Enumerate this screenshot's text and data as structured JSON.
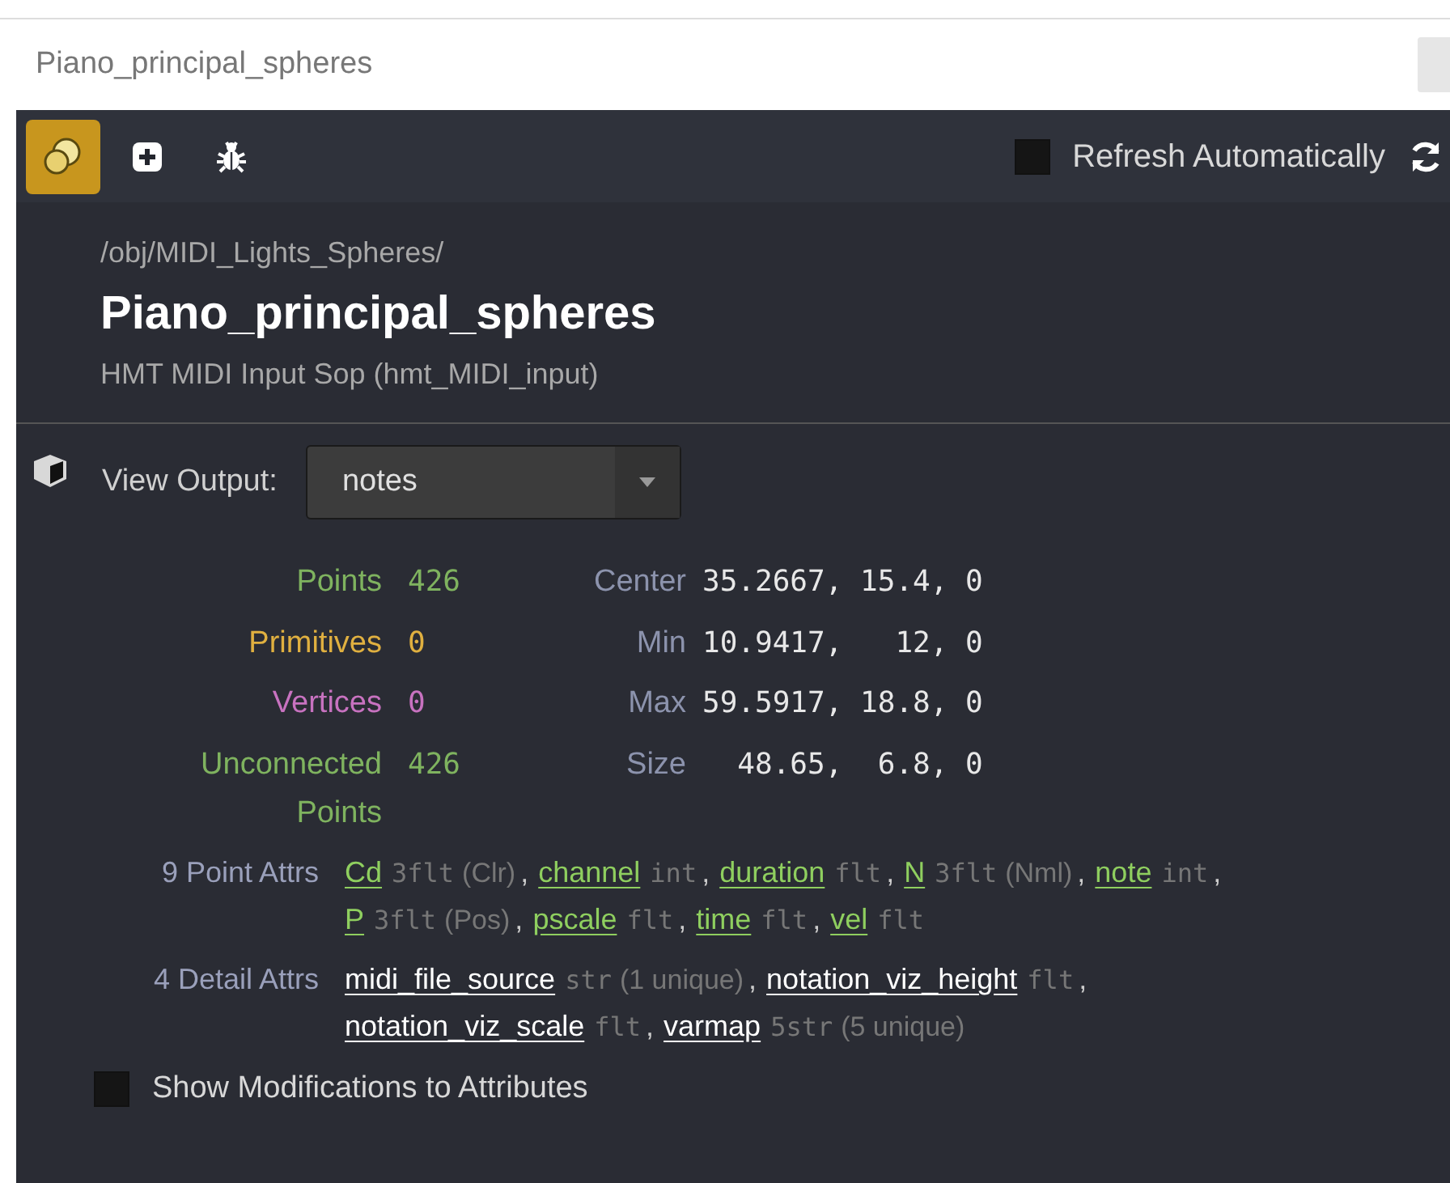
{
  "window": {
    "title": "Piano_principal_spheres"
  },
  "toolbar": {
    "buttons": [
      {
        "kind": "node",
        "selected": true
      },
      {
        "kind": "add",
        "selected": false
      },
      {
        "kind": "debug",
        "selected": false
      }
    ],
    "refresh": {
      "label": "Refresh Automatically",
      "checked": false
    }
  },
  "header": {
    "path": "/obj/MIDI_Lights_Spheres/",
    "name": "Piano_principal_spheres",
    "type": "HMT MIDI Input Sop (hmt_MIDI_input)"
  },
  "view_output": {
    "label": "View Output:",
    "value": "notes"
  },
  "counts": [
    {
      "label": "Points",
      "value": "426",
      "color": "#7fb35f"
    },
    {
      "label": "Primitives",
      "value": "0",
      "color": "#e0b040"
    },
    {
      "label": "Vertices",
      "value": "0",
      "color": "#c872c0"
    },
    {
      "label": "Unconnected Points",
      "value": "426",
      "color": "#7fb35f"
    }
  ],
  "bounds": [
    {
      "label": "Center",
      "value": "35.2667, 15.4, 0"
    },
    {
      "label": "Min",
      "value": "10.9417,   12, 0"
    },
    {
      "label": "Max",
      "value": "59.5917, 18.8, 0"
    },
    {
      "label": "Size",
      "value": "  48.65,  6.8, 0"
    }
  ],
  "attribute_groups": [
    {
      "label": "9 Point Attrs",
      "color": "#8fcf5f",
      "separator": ",",
      "attrs": [
        {
          "name": "Cd",
          "type": "3flt",
          "note": "(Clr)"
        },
        {
          "name": "channel",
          "type": "int"
        },
        {
          "name": "duration",
          "type": "flt"
        },
        {
          "name": "N",
          "type": "3flt",
          "note": "(Nml)"
        },
        {
          "name": "note",
          "type": "int"
        },
        {
          "name": "P",
          "type": "3flt",
          "note": "(Pos)"
        },
        {
          "name": "pscale",
          "type": "flt"
        },
        {
          "name": "time",
          "type": "flt"
        },
        {
          "name": "vel",
          "type": "flt"
        }
      ]
    },
    {
      "label": "4 Detail Attrs",
      "color": "#ffffff",
      "separator": ",",
      "attrs": [
        {
          "name": "midi_file_source",
          "type": "str",
          "note": "(1 unique)"
        },
        {
          "name": "notation_viz_height",
          "type": "flt"
        },
        {
          "name": "notation_viz_scale",
          "type": "flt"
        },
        {
          "name": "varmap",
          "type": "5str",
          "note": "(5 unique)"
        }
      ]
    }
  ],
  "show_modifications": {
    "label": "Show Modifications to Attributes",
    "checked": false
  }
}
